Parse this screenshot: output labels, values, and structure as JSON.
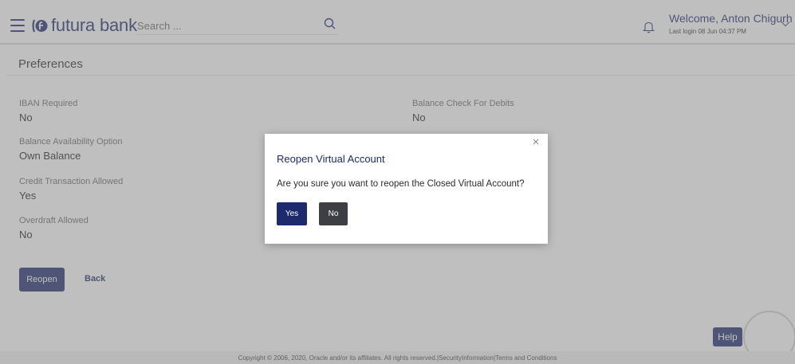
{
  "header": {
    "menu_icon": "hamburger-icon",
    "logo_icon": "futura-logo-icon",
    "logo_text": "futura bank",
    "search_placeholder": "Search ...",
    "search_icon": "search-icon",
    "notification_icon": "bell-icon",
    "welcome_text": "Welcome, Anton Chigurh",
    "last_login": "Last login 08 Jun 04:37 PM",
    "dropdown_icon": "chevron-down-icon"
  },
  "page": {
    "title": "Preferences",
    "fields": [
      {
        "label": "IBAN Required",
        "value": "No"
      },
      {
        "label": "Balance Check For Debits",
        "value": "No"
      },
      {
        "label": "Balance Availability Option",
        "value": "Own Balance"
      },
      {
        "label": "Credit Transaction Allowed",
        "value": "Yes"
      },
      {
        "label": "Overdraft Allowed",
        "value": "No"
      }
    ],
    "reopen_label": "Reopen",
    "back_label": "Back"
  },
  "help_label": "Help",
  "footer_text": "Copyright © 2006, 2020, Oracle and/or its affiliates. All rights reserved.|SecurityInformation|Terms and Conditions",
  "modal": {
    "close_icon": "close-icon",
    "title": "Reopen Virtual Account",
    "message": "Are you sure you want to reopen the Closed Virtual Account?",
    "yes_label": "Yes",
    "no_label": "No"
  },
  "colors": {
    "brand": "#1e2a6e",
    "secondary_button": "#3d3f44",
    "overlay": "#808080"
  }
}
